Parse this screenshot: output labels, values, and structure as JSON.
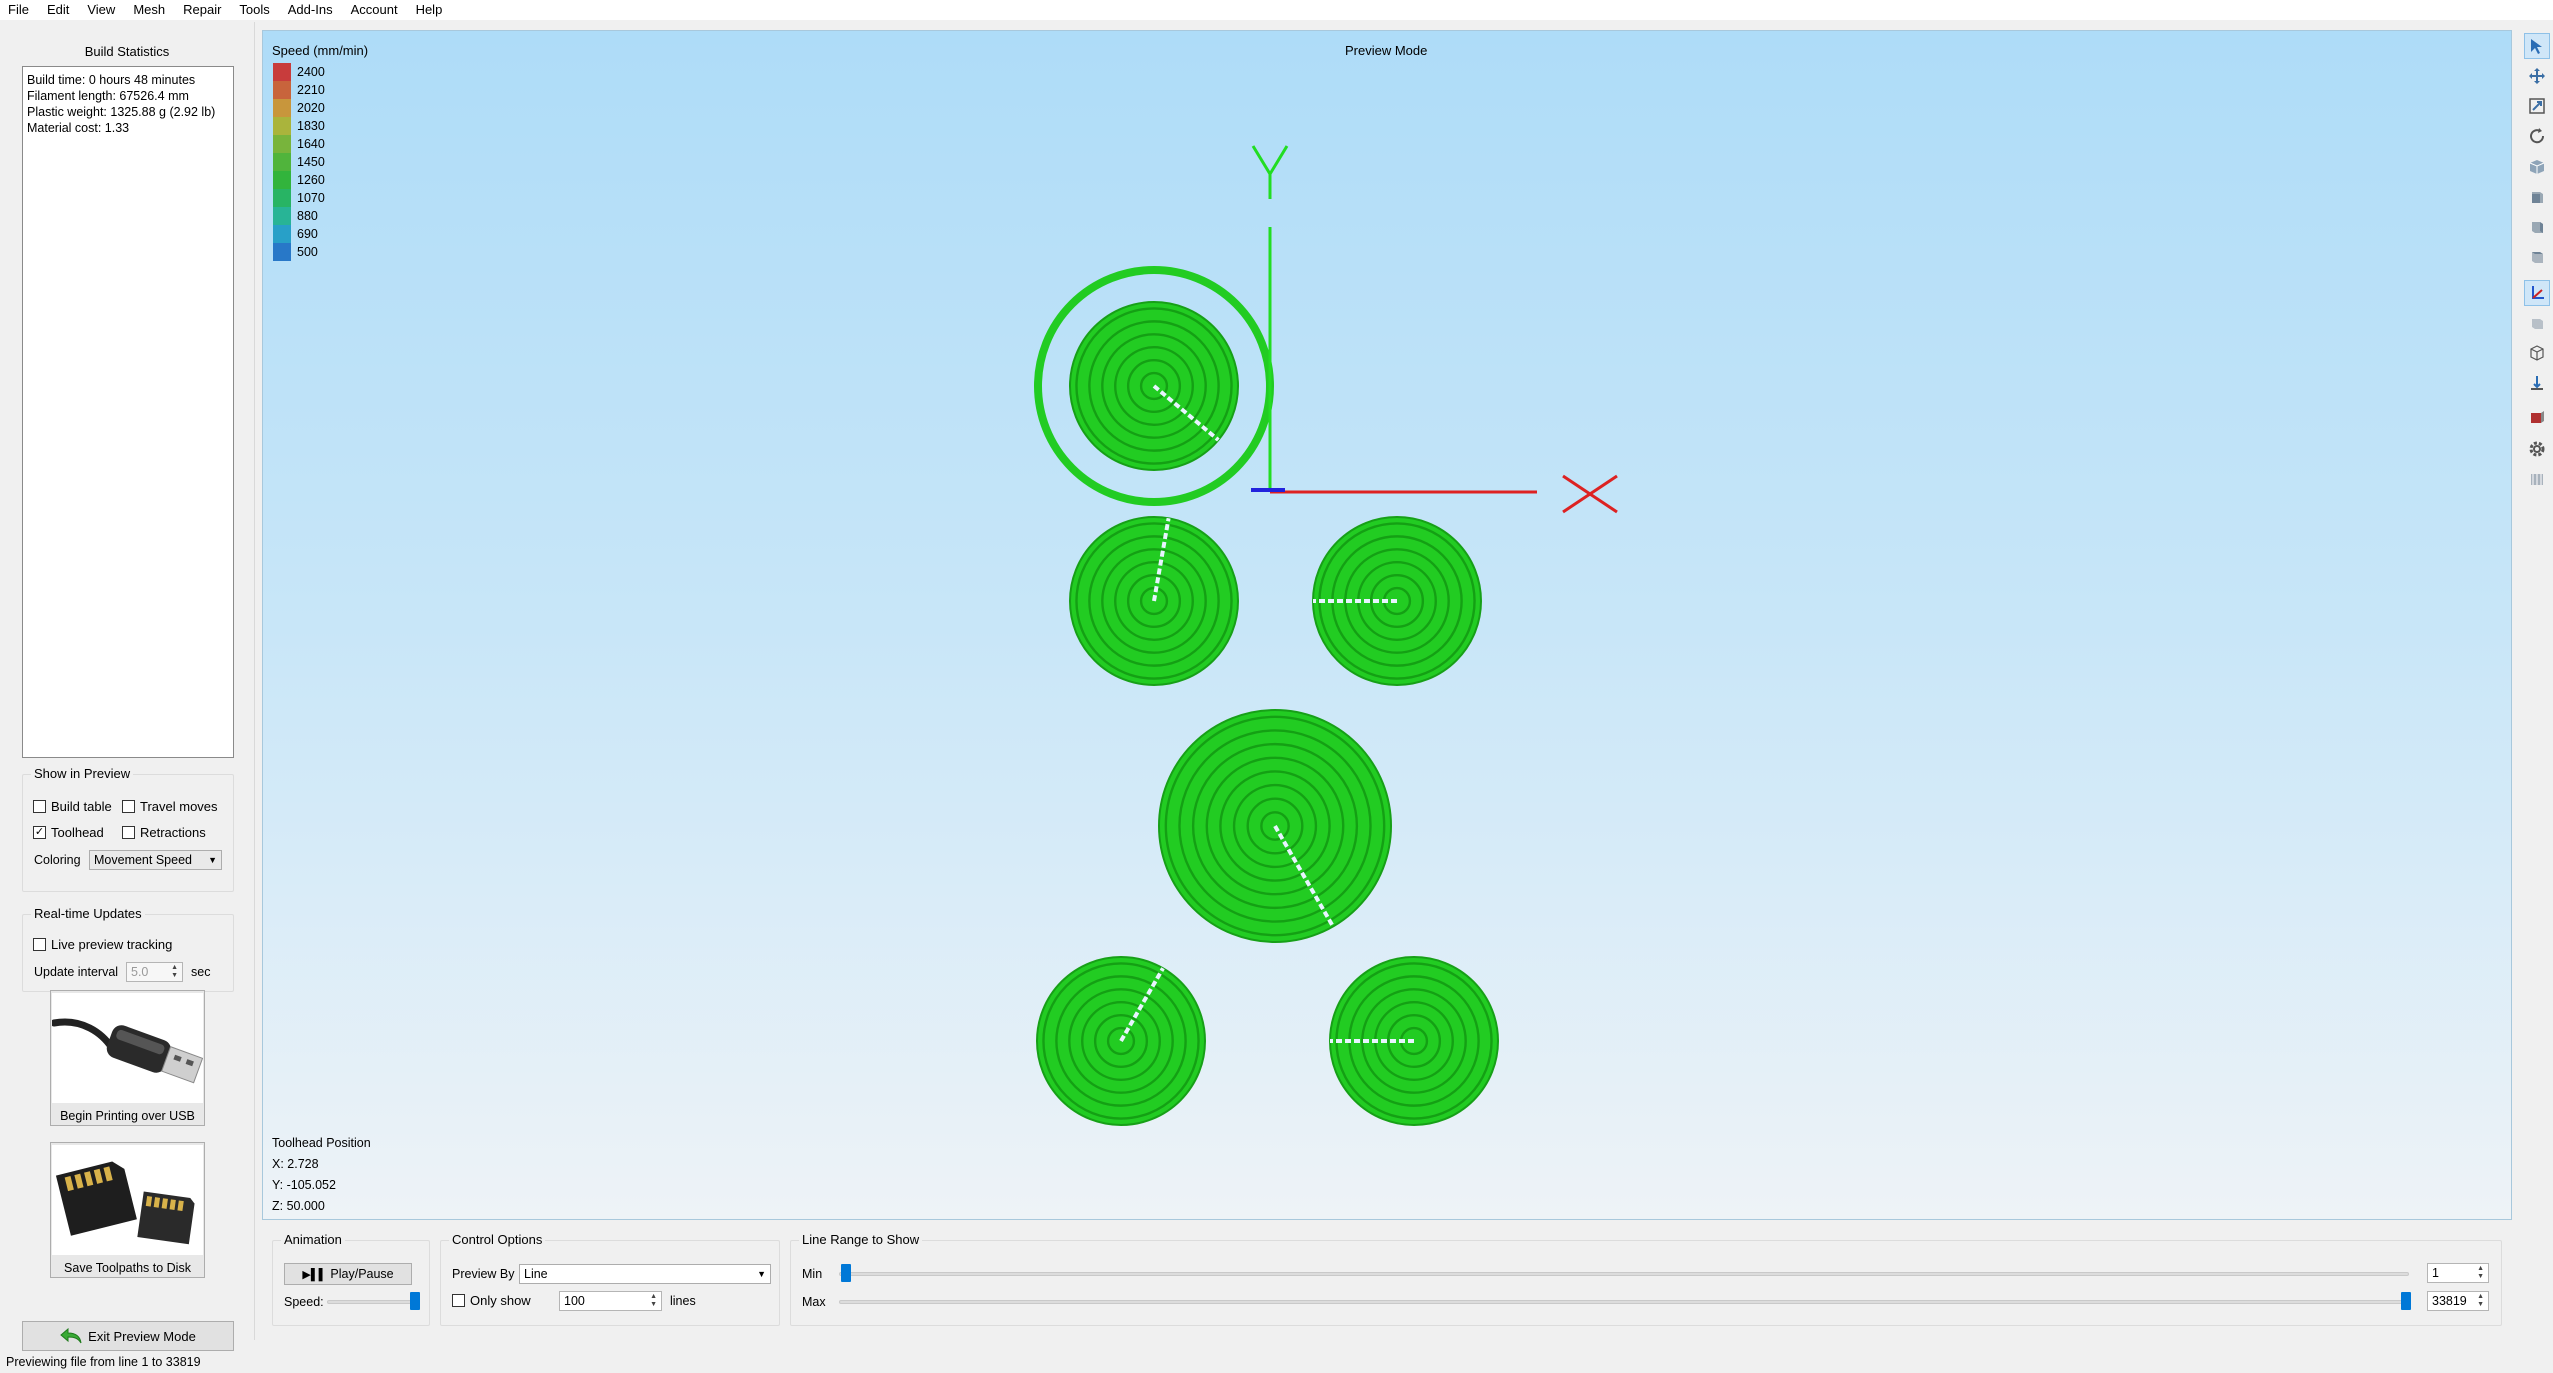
{
  "menu": [
    "File",
    "Edit",
    "View",
    "Mesh",
    "Repair",
    "Tools",
    "Add-Ins",
    "Account",
    "Help"
  ],
  "left_panel": {
    "title": "Build Statistics",
    "stats": [
      "Build time: 0 hours 48 minutes",
      "Filament length: 67526.4 mm",
      "Plastic weight: 1325.88 g (2.92 lb)",
      "Material cost: 1.33"
    ],
    "show_in_preview": {
      "title": "Show in Preview",
      "build_table": {
        "label": "Build table",
        "checked": false
      },
      "travel_moves": {
        "label": "Travel moves",
        "checked": false
      },
      "toolhead": {
        "label": "Toolhead",
        "checked": true
      },
      "retractions": {
        "label": "Retractions",
        "checked": false
      },
      "coloring_label": "Coloring",
      "coloring_value": "Movement Speed"
    },
    "realtime": {
      "title": "Real-time Updates",
      "live_preview": {
        "label": "Live preview tracking",
        "checked": false
      },
      "interval_label": "Update interval",
      "interval_value": "5.0",
      "interval_unit": "sec"
    },
    "usb_button": "Begin Printing over USB",
    "sd_button": "Save Toolpaths to Disk",
    "exit_button": "Exit Preview Mode"
  },
  "viewport": {
    "legend_title": "Speed (mm/min)",
    "legend": [
      {
        "value": "2400",
        "color": "#c83c3c"
      },
      {
        "value": "2210",
        "color": "#c8643c"
      },
      {
        "value": "2020",
        "color": "#c8963c"
      },
      {
        "value": "1830",
        "color": "#aab43c"
      },
      {
        "value": "1640",
        "color": "#78b43c"
      },
      {
        "value": "1450",
        "color": "#50b43c"
      },
      {
        "value": "1260",
        "color": "#32b43c"
      },
      {
        "value": "1070",
        "color": "#28b464"
      },
      {
        "value": "880",
        "color": "#28b496"
      },
      {
        "value": "690",
        "color": "#28a0c8"
      },
      {
        "value": "500",
        "color": "#2878c8"
      }
    ],
    "title": "Preview Mode",
    "axis_x": "X",
    "axis_y": "Y",
    "toolhead_title": "Toolhead Position",
    "toolhead_x": "X: 2.728",
    "toolhead_y": "Y: -105.052",
    "toolhead_z": "Z: 50.000",
    "toolpath_color": "#22cc22"
  },
  "bottom": {
    "animation": {
      "title": "Animation",
      "play_label": "Play/Pause",
      "speed_label": "Speed:"
    },
    "control": {
      "title": "Control Options",
      "preview_by_label": "Preview By",
      "preview_by_value": "Line",
      "only_show_label": "Only show",
      "only_show_value": "100",
      "lines_label": "lines"
    },
    "range": {
      "title": "Line Range to Show",
      "min_label": "Min",
      "min_value": "1",
      "max_label": "Max",
      "max_value": "33819"
    }
  },
  "status": "Previewing file from line 1 to 33819"
}
